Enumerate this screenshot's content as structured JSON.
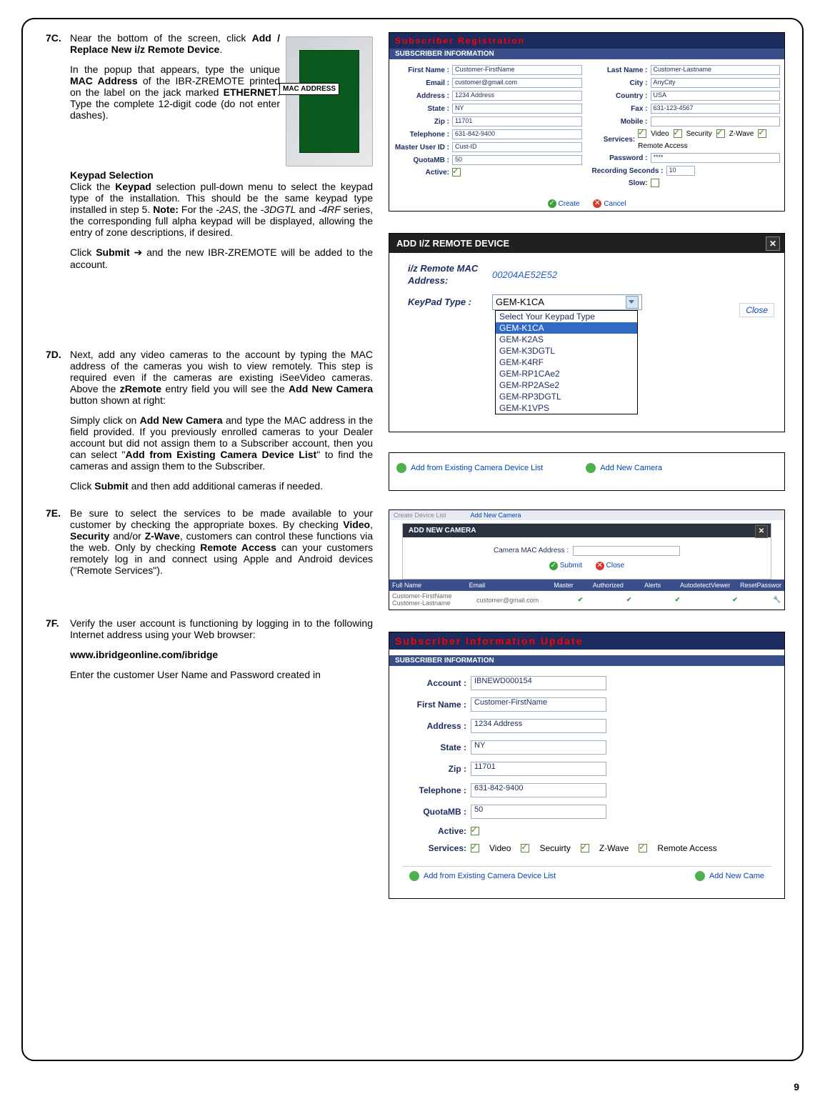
{
  "page_number": "9",
  "hw_label": "MAC ADDRESS",
  "steps": {
    "c": {
      "num": "7C.",
      "p1_1": "Near the bottom of the screen, click ",
      "p1_b1": "Add / Replace New i/z Remote Device",
      "p1_2": ".",
      "p2_1": "In the popup that appears, type the unique ",
      "p2_b1": "MAC Address",
      "p2_2": " of the IBR-ZREMOTE printed on the label on the jack marked ",
      "p2_b2": "ETHERNET",
      "p2_3": ". Type the complete 12-digit code (do not enter dashes).",
      "ks_head": "Keypad Selection",
      "ks_1": "Click the ",
      "ks_b1": "Keypad",
      "ks_2": " selection pull-down menu to select the keypad type of the installation. This should be the same keypad type installed in step 5. ",
      "ks_b2": "Note:",
      "ks_3": " For the ",
      "ks_i1": "-2AS",
      "ks_4": ", the ",
      "ks_i2": "-3DGTL",
      "ks_5": " and ",
      "ks_i3": "-4RF",
      "ks_6": " series, the corresponding full alpha keypad will be displayed, allowing the entry of zone descriptions, if desired.",
      "ks_7a": "Click ",
      "ks_7b": "Submit",
      "ks_7arrow": " ➔ ",
      "ks_7c": "and the new IBR-ZREMOTE will be added to the account."
    },
    "d": {
      "num": "7D.",
      "p1_1": "Next, add any video cameras to the account by typing the MAC address of the cameras you wish to view remotely. This step is required even if the cameras are existing iSeeVideo cameras. Above the ",
      "p1_b1": "zRemote",
      "p1_2": " entry field you will see the ",
      "p1_b2": "Add New Camera",
      "p1_3": " button shown at right:",
      "p2_1": "Simply click on ",
      "p2_b1": "Add New Camera",
      "p2_2": " and type the MAC address in the field provided. If you previously enrolled cameras to your Dealer account but did not assign them to a Subscriber account, then you can select \"",
      "p2_b2": "Add from Existing Camera Device List",
      "p2_3": "\" to find the cameras and assign them to the Subscriber.",
      "p3_1": "Click ",
      "p3_b1": "Submit",
      "p3_2": " and then add additional cameras if needed."
    },
    "e": {
      "num": "7E.",
      "p1_1": "Be sure to select the services to be made available to your customer by checking the appropriate boxes. By checking ",
      "p1_b1": "Video",
      "p1_b2": "Security",
      "p1_b3": "Z-Wave",
      "p1_mid1": ", ",
      "p1_mid2": " and/or ",
      "p1_2": ", customers can control these functions via the web. Only by checking ",
      "p1_b4": "Remote Access",
      "p1_3": " can your customers remotely log in and connect using Apple and Android devices (\"Remote Services\")."
    },
    "f": {
      "num": "7F.",
      "p1": "Verify the user account is functioning by logging in to the following Internet address using your Web browser:",
      "url": "www.ibridgeonline.com/ibridge",
      "p2": "Enter the customer User Name and Password created in"
    }
  },
  "reg_panel": {
    "title": "Subscriber Registration",
    "subheader": "SUBSCRIBER INFORMATION",
    "left": {
      "FirstName": {
        "label": "First Name :",
        "value": "Customer-FirstName"
      },
      "Email": {
        "label": "Email :",
        "value": "customer@gmail.com"
      },
      "Address": {
        "label": "Address :",
        "value": "1234 Address"
      },
      "State": {
        "label": "State :",
        "value": "NY"
      },
      "Zip": {
        "label": "Zip :",
        "value": "11701"
      },
      "Telephone": {
        "label": "Telephone :",
        "value": "631-842-9400"
      },
      "MasterUID": {
        "label": "Master User ID :",
        "value": "Cust-ID"
      },
      "QuotaMB": {
        "label": "QuotaMB :",
        "value": "50"
      },
      "Active": {
        "label": "Active:",
        "checked": true
      }
    },
    "right": {
      "LastName": {
        "label": "Last Name :",
        "value": "Customer-Lastname"
      },
      "City": {
        "label": "City :",
        "value": "AnyCity"
      },
      "Country": {
        "label": "Country :",
        "value": "USA"
      },
      "Fax": {
        "label": "Fax :",
        "value": "631-123-4567"
      },
      "Mobile": {
        "label": "Mobile :",
        "value": ""
      },
      "Services": {
        "label": "Services:",
        "items": [
          "Video",
          "Security",
          "Z-Wave",
          "Remote Access"
        ]
      },
      "Password": {
        "label": "Password :",
        "value": "****"
      },
      "RecordingSeconds": {
        "label": "Recording Seconds :",
        "value": "10"
      },
      "Slow": {
        "label": "Slow:",
        "checked": false
      }
    },
    "buttons": {
      "create": "Create",
      "cancel": "Cancel"
    }
  },
  "iz_panel": {
    "title": "ADD I/Z REMOTE  DEVICE",
    "maclbl": "i/z Remote MAC Address:",
    "macval": "00204AE52E52",
    "kplbl": "KeyPad Type :",
    "selected": "GEM-K1CA",
    "close": "Close",
    "options": [
      "Select Your Keypad Type",
      "GEM-K1CA",
      "GEM-K2AS",
      "GEM-K3DGTL",
      "GEM-K4RF",
      "GEM-RP1CAe2",
      "GEM-RP2ASe2",
      "GEM-RP3DGTL",
      "GEM-K1VPS"
    ]
  },
  "cam_links": {
    "existing": "Add from Existing Camera Device List",
    "addnew": "Add New Camera"
  },
  "addcam": {
    "top_link1": "Create Device List",
    "top_link2": "Add New Camera",
    "modal_title": "ADD NEW CAMERA",
    "maclbl": "Camera MAC Address :",
    "submit": "Submit",
    "close": "Close",
    "cols": [
      "Full Name",
      "Email",
      "Master",
      "Authorized",
      "Alerts",
      "AutodetectViewer",
      "ResetPasswor"
    ],
    "row": {
      "name": "Customer-FirstName Customer-Lastname",
      "email": "customer@gmail.com"
    }
  },
  "upd_panel": {
    "title": "Subscriber Information Update",
    "subheader": "SUBSCRIBER INFORMATION",
    "fields": {
      "Account": {
        "label": "Account :",
        "value": "IBNEWD000154"
      },
      "FirstName": {
        "label": "First Name :",
        "value": "Customer-FirstName"
      },
      "Address": {
        "label": "Address :",
        "value": "1234 Address"
      },
      "State": {
        "label": "State :",
        "value": "NY"
      },
      "Zip": {
        "label": "Zip :",
        "value": "11701"
      },
      "Telephone": {
        "label": "Telephone :",
        "value": "631-842-9400"
      },
      "QuotaMB": {
        "label": "QuotaMB :",
        "value": "50"
      },
      "Active": {
        "label": "Active:"
      },
      "Services": {
        "label": "Services:",
        "items": [
          "Video",
          "Secuirty",
          "Z-Wave",
          "Remote Access"
        ]
      }
    },
    "foot": {
      "existing": "Add from Existing Camera Device List",
      "addnew": "Add New Came"
    }
  }
}
